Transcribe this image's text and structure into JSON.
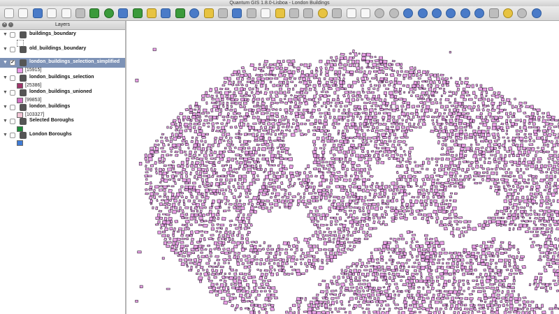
{
  "window": {
    "title": "Quantum GIS 1.8.0-Lisboa - London Buildings"
  },
  "toolbar": {
    "icons": [
      "new-project-icon",
      "open-project-icon",
      "save-project-icon",
      "save-as-icon",
      "print-composer-icon",
      "print-icon",
      "pan-icon",
      "zoom-in-icon",
      "zoom-out-icon",
      "zoom-full-icon",
      "zoom-layer-icon",
      "zoom-selection-icon",
      "zoom-last-icon",
      "refresh-icon",
      "identify-icon",
      "select-icon",
      "measure-icon",
      "edit-icon",
      "save-edits-icon",
      "add-feature-icon",
      "move-feature-icon",
      "node-tool-icon",
      "delete-icon",
      "cut-icon",
      "copy-icon",
      "paste-icon",
      "undo-icon",
      "redo-icon",
      "add-vector-icon",
      "add-raster-icon",
      "add-postgis-icon",
      "add-spatialite-icon",
      "add-wms-icon",
      "add-wfs-icon",
      "new-layer-icon",
      "map-tips-icon",
      "bookmark-icon",
      "help-icon"
    ]
  },
  "layers_panel": {
    "title": "Layers",
    "layers": [
      {
        "name": "buildings_boundary",
        "checked": false,
        "swatch": ""
      },
      {
        "name": "old_buildings_boundary",
        "checked": false,
        "swatch": ""
      },
      {
        "name": "london_buildings_selection_simplified",
        "checked": true,
        "selected": true,
        "count": "[15915]",
        "swatch": "#e99ae6"
      },
      {
        "name": "london_buildings_selection",
        "checked": false,
        "count": "[25386]",
        "swatch": "#a0356a"
      },
      {
        "name": "london_buildings_unioned",
        "checked": false,
        "count": "[99853]",
        "swatch": "#cf6fbf"
      },
      {
        "name": "london_buildings",
        "checked": false,
        "count": "[103327]",
        "swatch": "#f3c6d6"
      },
      {
        "name": "Selected Boroughs",
        "checked": false,
        "swatch": "#1e8c3a"
      },
      {
        "name": "London Boroughs",
        "checked": false,
        "swatch": "#3e7bd6"
      }
    ]
  },
  "map": {
    "fill_color": "#e9a0e6",
    "stroke_color": "#2e2233"
  }
}
